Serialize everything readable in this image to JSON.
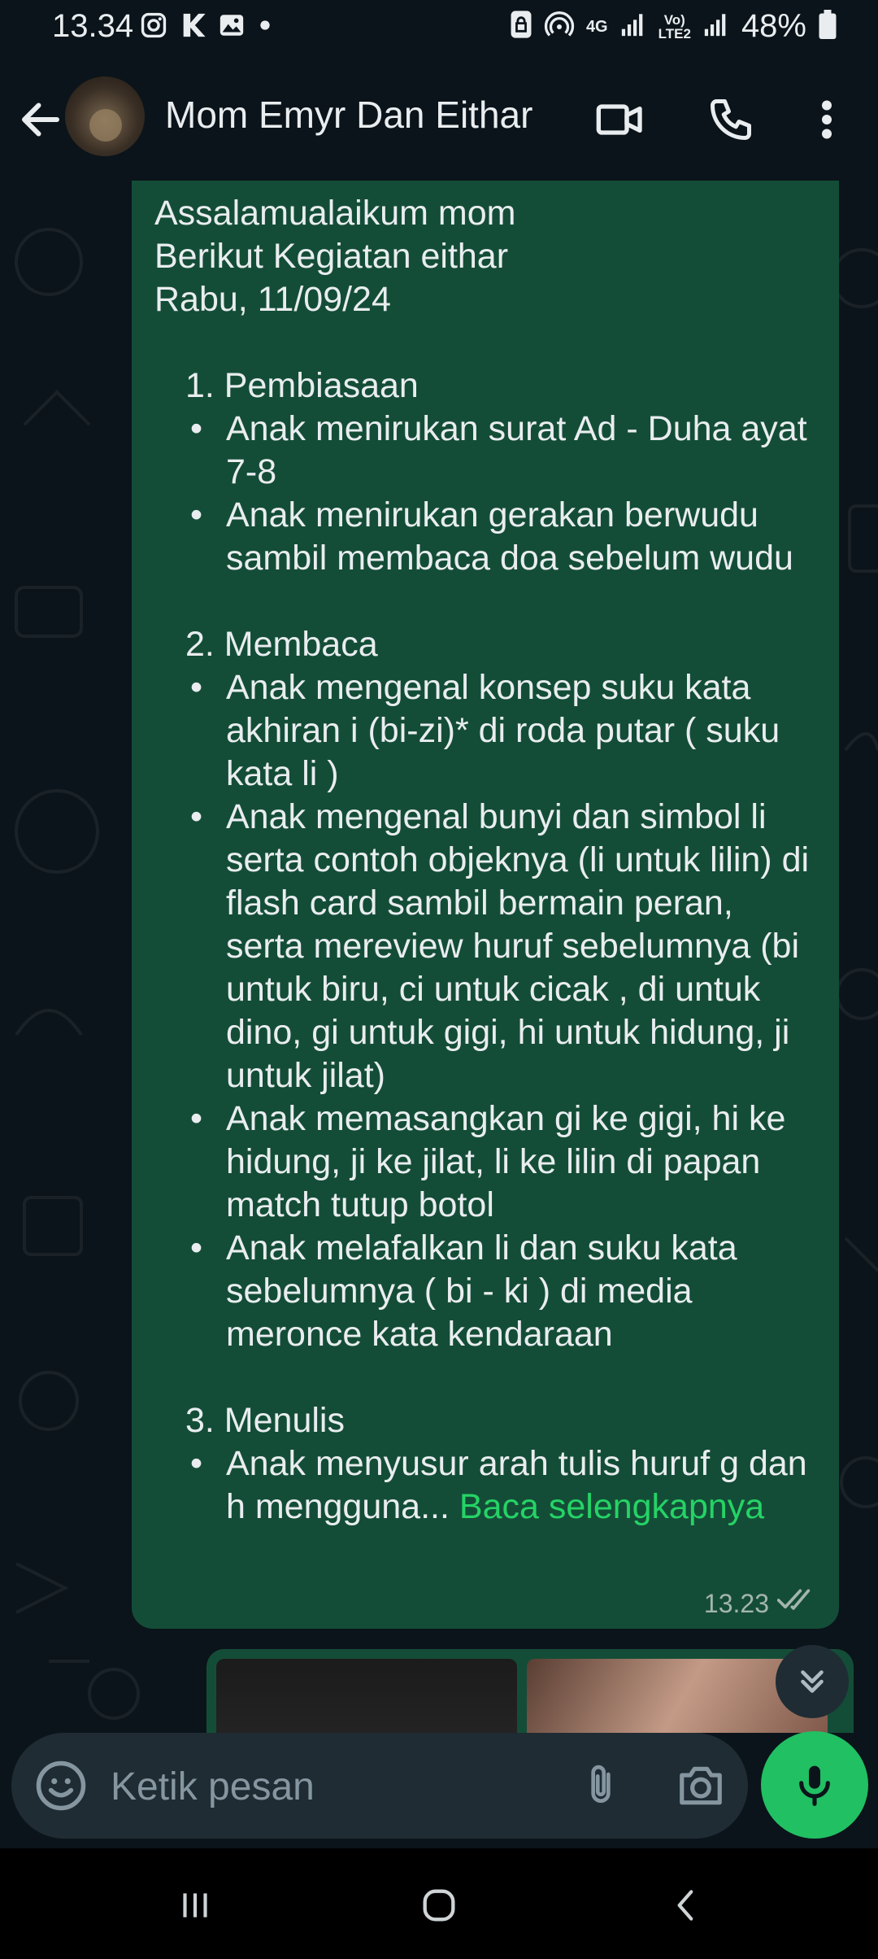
{
  "status_bar": {
    "time": "13.34",
    "network": "4G",
    "battery": "48%",
    "icons": [
      "instagram-icon",
      "k-app-icon",
      "gallery-icon",
      "dot-icon",
      "lock-icon",
      "hotspot-icon",
      "signal-icon",
      "volte-icon",
      "battery-icon"
    ]
  },
  "header": {
    "contact_name": "Mom Emyr Dan Eithar",
    "icons": [
      "back-arrow-icon",
      "video-call-icon",
      "phone-icon",
      "more-vert-icon"
    ]
  },
  "message": {
    "lines": [
      "Assalamualaikum mom",
      "Berikut Kegiatan eithar",
      "Rabu, 11/09/24"
    ],
    "sections": [
      {
        "title": "1. Pembiasaan",
        "items": [
          "Anak menirukan surat Ad - Duha ayat 7-8",
          "Anak menirukan gerakan berwudu sambil membaca doa sebelum wudu"
        ]
      },
      {
        "title": "2. Membaca",
        "items": [
          "Anak mengenal konsep suku kata akhiran i (bi-zi)* di roda putar ( suku kata li )",
          "Anak mengenal bunyi dan simbol li serta contoh objeknya (li untuk lilin) di flash card sambil bermain peran, serta mereview huruf sebelumnya (bi untuk biru, ci untuk cicak , di untuk dino, gi untuk gigi, hi untuk hidung, ji untuk jilat)",
          "Anak memasangkan gi ke gigi,  hi ke hidung, ji ke jilat, li ke lilin di papan match tutup botol",
          "Anak melafalkan li dan suku kata sebelumnya ( bi - ki ) di media meronce kata kendaraan"
        ]
      },
      {
        "title": "3. Menulis",
        "items": [
          "Anak menyusur arah tulis huruf g dan h  mengguna..."
        ]
      }
    ],
    "read_more": "Baca selengkapnya",
    "time": "13.23",
    "status": "read"
  },
  "composer": {
    "placeholder": "Ketik pesan"
  },
  "colors": {
    "background": "#0b141a",
    "bubble": "#144d37",
    "accent_green": "#25d366",
    "mic_button": "#21c063",
    "composer": "#1f2c34"
  }
}
